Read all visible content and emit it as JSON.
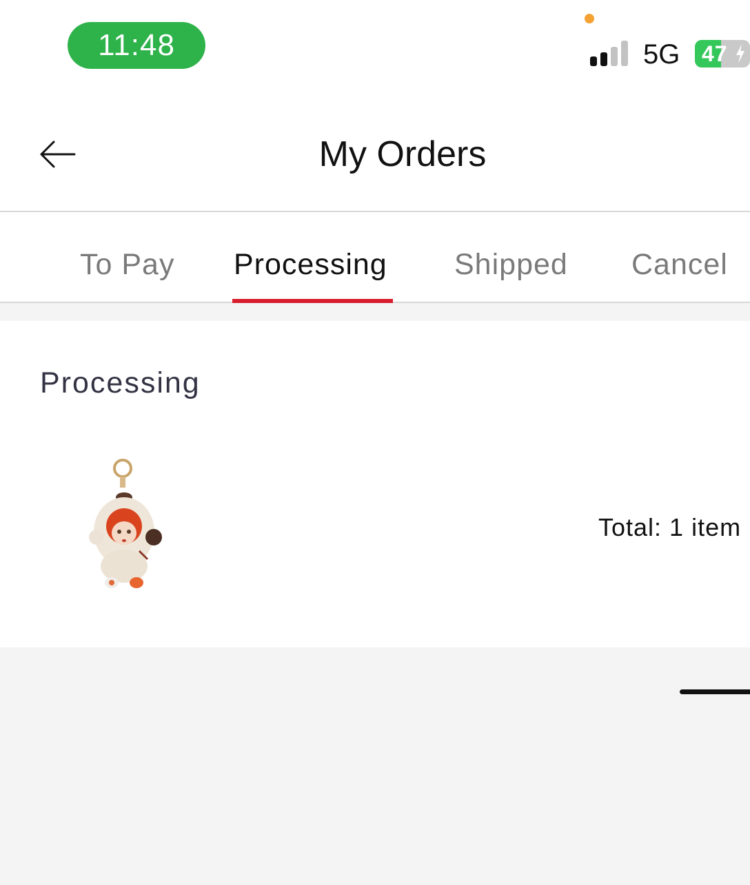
{
  "status_bar": {
    "time": "11:48",
    "network": "5G",
    "battery": "47",
    "battery_level": 0.47,
    "signal_bars": 2,
    "time_pill_color": "#2eb24a",
    "battery_color": "#34c759"
  },
  "header": {
    "title": "My Orders",
    "back_icon": "arrow-left-icon"
  },
  "tabs": [
    {
      "label": "To Pay",
      "active": false
    },
    {
      "label": "Processing",
      "active": true
    },
    {
      "label": "Shipped",
      "active": false
    },
    {
      "label": "Cancel",
      "active": false
    }
  ],
  "accent_color": "#d81e2e",
  "order": {
    "status": "Processing",
    "product_icon": "doll-keychain-thumbnail",
    "total_text": "Total: 1 item"
  }
}
